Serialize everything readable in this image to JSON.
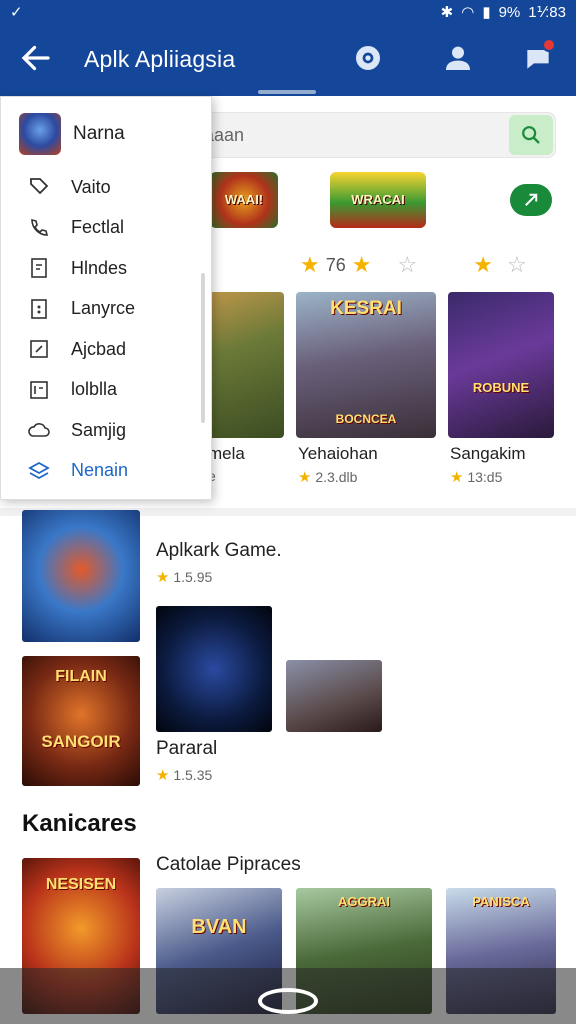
{
  "status_bar": {
    "left_glyph": "✓",
    "signal": "9%",
    "time": "1⅟:83"
  },
  "app_bar": {
    "title": "Aplk Apliiagsia"
  },
  "search": {
    "placeholder": "Qecaaan"
  },
  "drawer": {
    "profile_name": "Narna",
    "items": [
      {
        "label": "Vaito",
        "icon": "tag-icon"
      },
      {
        "label": "Fectlal",
        "icon": "phone-icon"
      },
      {
        "label": "Hlndes",
        "icon": "document-icon"
      },
      {
        "label": "Lanyrce",
        "icon": "grid-icon"
      },
      {
        "label": "Ajcbad",
        "icon": "edit-icon"
      },
      {
        "label": "lolblla",
        "icon": "file-icon"
      },
      {
        "label": "Samjig",
        "icon": "cloud-icon"
      },
      {
        "label": "Nenain",
        "icon": "layers-icon"
      }
    ]
  },
  "featured": {
    "rating_value": "76",
    "cards": [
      {
        "name": "melа",
        "rating": "e",
        "label": ""
      },
      {
        "name": "Yehaiohan",
        "rating": "2.3.dlb",
        "label": "KESRAI"
      },
      {
        "name": "Sangakim",
        "rating": "13:d5",
        "label": ""
      }
    ],
    "card2_sublabel": "BOCNCEA"
  },
  "lower": {
    "section1_title": "Aplkark Game.",
    "section1_rating": "1.5.95",
    "section2_title": "Pararal",
    "section2_rating": "1.5.35",
    "heading": "Kanicares",
    "section3_title": "Catolae Pipraces",
    "tile_labels": {
      "fllan": "FILAIN",
      "sangoir": "SANGOIR",
      "nesien": "NESISEN",
      "bvan": "BVAN",
      "aggrai": "AGGRAI",
      "panisca": "PANISCA"
    }
  }
}
